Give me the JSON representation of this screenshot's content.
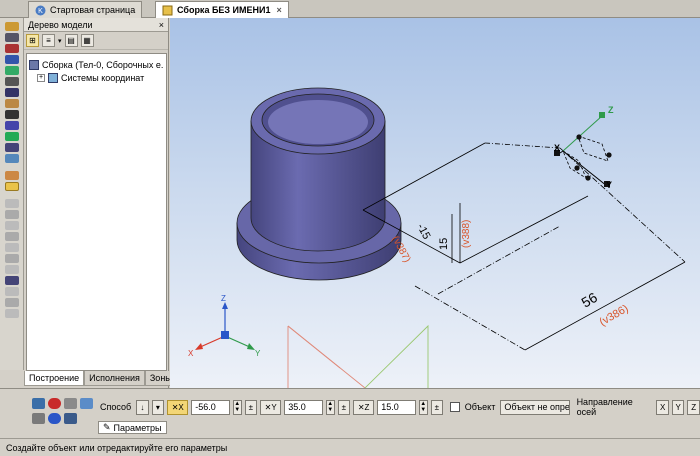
{
  "tabs": [
    {
      "label": "Стартовая страница",
      "icon": "home-icon"
    },
    {
      "label": "Сборка БЕЗ ИМЕНИ1",
      "icon": "assembly-icon",
      "close": "×"
    }
  ],
  "model_tree": {
    "title": "Дерево модели",
    "close": "×",
    "root": "Сборка (Тел-0, Сборочных е.",
    "child": "Системы координат",
    "expand": "+",
    "bottom_tabs": [
      "Построение",
      "Исполнения",
      "Зоны"
    ]
  },
  "viewport": {
    "dimensions": {
      "d1_value": "15",
      "d1_variable": "(v388)",
      "d2_value": "-15",
      "d2_variable": "(v387)",
      "d3_value": "56",
      "d3_variable": "(v386)"
    },
    "axis_labels": {
      "x": "X",
      "y": "Y",
      "z": "Z"
    },
    "triad_labels": {
      "x": "X",
      "y": "Y",
      "z": "Z"
    },
    "colors": {
      "part": "#5a5a9c",
      "dimension_variable": "#d9552a",
      "axis_x": "#d83a2a",
      "axis_y": "#2f9a4a",
      "axis_z": "#2a56c8"
    }
  },
  "properties": {
    "method_label": "Способ",
    "x_label": "X",
    "x_value": "-56.0",
    "y_label": "Y",
    "y_value": "35.0",
    "z_label": "Z",
    "z_value": "15.0",
    "object_label": "Объект",
    "object_value": "Объект не опреде",
    "axis_direction_label": "Направление осей",
    "axis_buttons": [
      "X",
      "Y",
      "Z"
    ],
    "params_tab": "Параметры"
  },
  "status": "Создайте объект или отредактируйте его параметры"
}
